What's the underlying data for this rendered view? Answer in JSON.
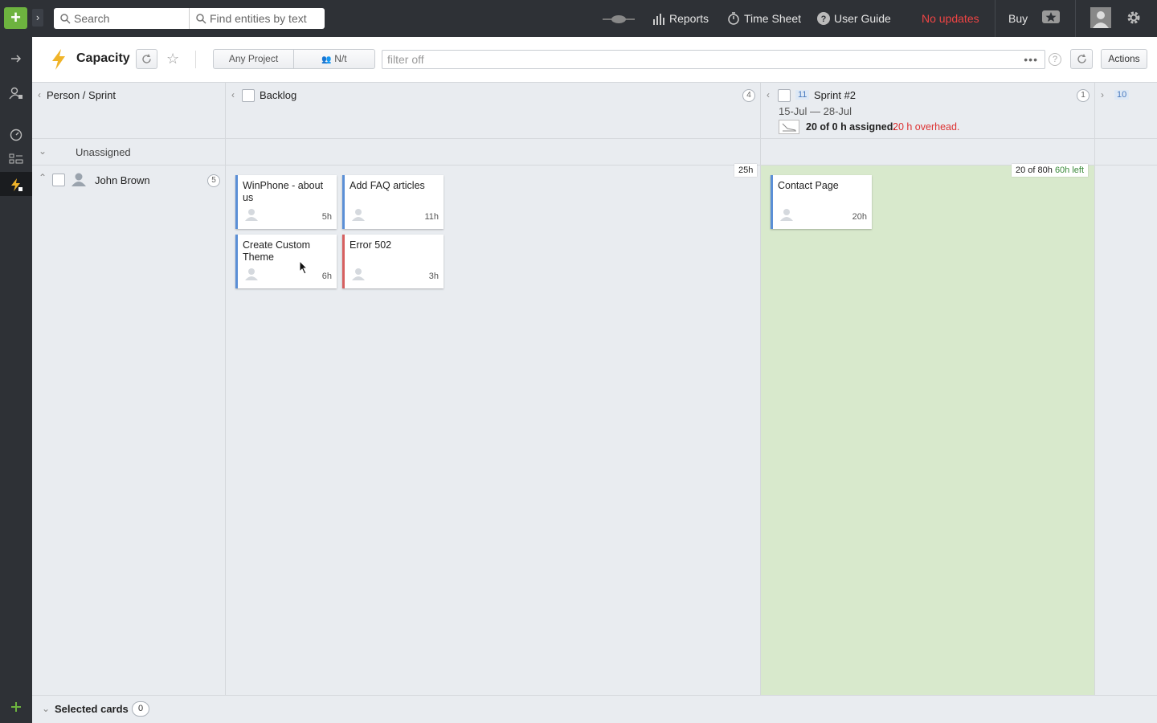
{
  "topbar": {
    "add_label": "+",
    "search_placeholder": "Search",
    "find_placeholder": "Find entities by text",
    "reports_label": "Reports",
    "timesheet_label": "Time Sheet",
    "guide_label": "User Guide",
    "updates_label": "No updates",
    "buy_label": "Buy"
  },
  "header": {
    "title": "Capacity",
    "project_filter": "Any Project",
    "team_filter": "N/t",
    "filter_text": "filter off",
    "actions_label": "Actions"
  },
  "columns": {
    "axis_label": "Person / Sprint",
    "backlog": {
      "label": "Backlog",
      "count": "4",
      "total": "25h"
    },
    "sprint": {
      "id": "11",
      "label": "Sprint #2",
      "count": "1",
      "dates": "15-Jul — 28-Jul",
      "assigned": "20 of 0 h assigned.",
      "overhead": "20 h overhead.",
      "capacity": "20 of 80h",
      "left": "60h left"
    },
    "next": {
      "id": "10"
    }
  },
  "rows": {
    "unassigned_label": "Unassigned",
    "person": {
      "name": "John Brown",
      "count": "5"
    }
  },
  "cards": [
    {
      "title": "WinPhone - about us",
      "hours": "5",
      "unit": "h",
      "color": "#5b8fd6"
    },
    {
      "title": "Add FAQ articles",
      "hours": "11",
      "unit": "h",
      "color": "#5b8fd6"
    },
    {
      "title": "Create Custom Theme",
      "hours": "6",
      "unit": "h",
      "color": "#5b8fd6"
    },
    {
      "title": "Error 502",
      "hours": "3",
      "unit": "h",
      "color": "#d66060"
    },
    {
      "title": "Contact Page",
      "hours": "20",
      "unit": "h",
      "color": "#5b8fd6"
    }
  ],
  "footer": {
    "label": "Selected cards",
    "count": "0"
  },
  "colors": {
    "topbar": "#2e3136",
    "accent_green": "#6db33f",
    "sprint_bg": "#d8e9cc",
    "alert_red": "#ef4444"
  }
}
